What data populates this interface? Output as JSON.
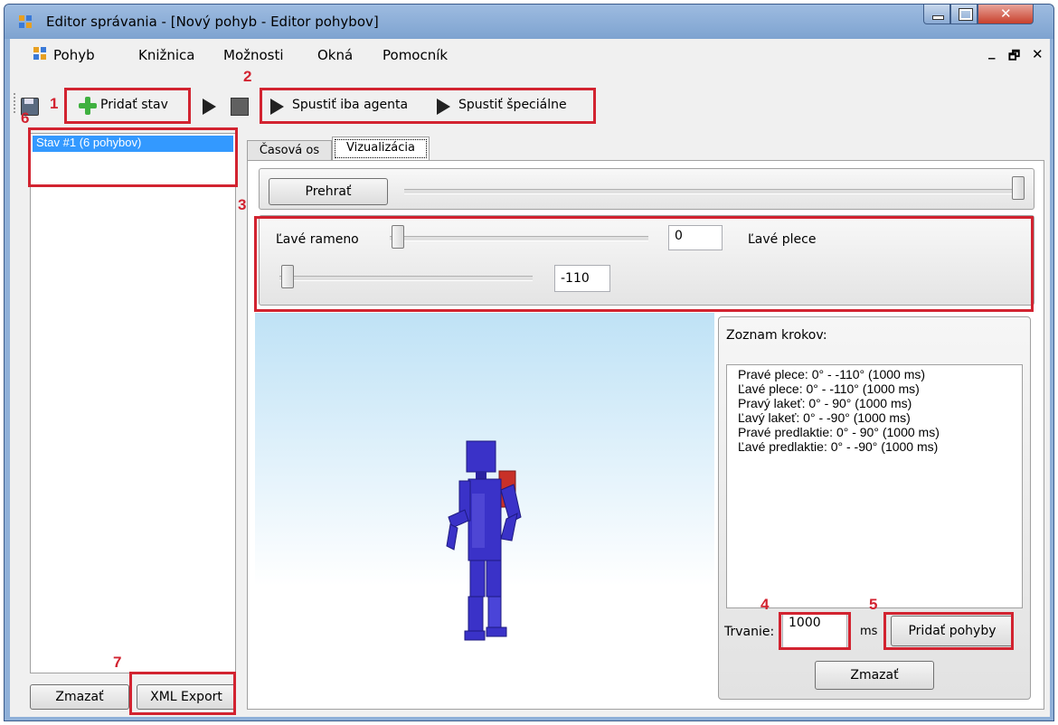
{
  "window": {
    "title": "Editor správania - [Nový pohyb - Editor pohybov]"
  },
  "menu": {
    "items": [
      "Pohyb",
      "Knižnica",
      "Možnosti",
      "Okná",
      "Pomocník"
    ]
  },
  "toolbar": {
    "add_state": "Pridať stav",
    "run_agent": "Spustiť iba agenta",
    "run_special": "Spustiť špeciálne"
  },
  "left_panel": {
    "states": [
      "Stav #1 (6 pohybov)"
    ],
    "delete_button": "Zmazať",
    "export_button": "XML Export"
  },
  "tabs": [
    "Časová os",
    "Vizualizácia"
  ],
  "active_tab": "Vizualizácia",
  "playback": {
    "play_button": "Prehrať",
    "position_fraction": 1.0
  },
  "joints": {
    "slider1_label": "Ľavé rameno",
    "slider1_value": "0",
    "slider1_target": "Ľavé plece",
    "slider2_value": "-110"
  },
  "steps": {
    "title": "Zoznam krokov:",
    "items": [
      "Pravé plece: 0° - -110° (1000 ms)",
      "Ľavé plece: 0° - -110° (1000 ms)",
      "Pravý lakeť: 0° - 90° (1000 ms)",
      "Ľavý lakeť: 0° - -90° (1000 ms)",
      "Pravé predlaktie: 0° - 90° (1000 ms)",
      "Ľavé predlaktie: 0° - -90° (1000 ms)"
    ],
    "duration_label": "Trvanie:",
    "duration_value": "1000",
    "duration_unit": "ms",
    "add_button": "Pridať pohyby",
    "delete_button": "Zmazať"
  },
  "annotations": [
    "1",
    "2",
    "3",
    "4",
    "5",
    "6",
    "7"
  ],
  "colors": {
    "annotation": "#d22330",
    "selection": "#3399ff",
    "robot_body": "#3a32c8",
    "robot_backpack": "#c83028"
  },
  "icons": [
    "app-icon",
    "save-icon",
    "add-icon",
    "play-icon",
    "stop-icon",
    "minimize-icon",
    "maximize-icon",
    "close-icon"
  ]
}
